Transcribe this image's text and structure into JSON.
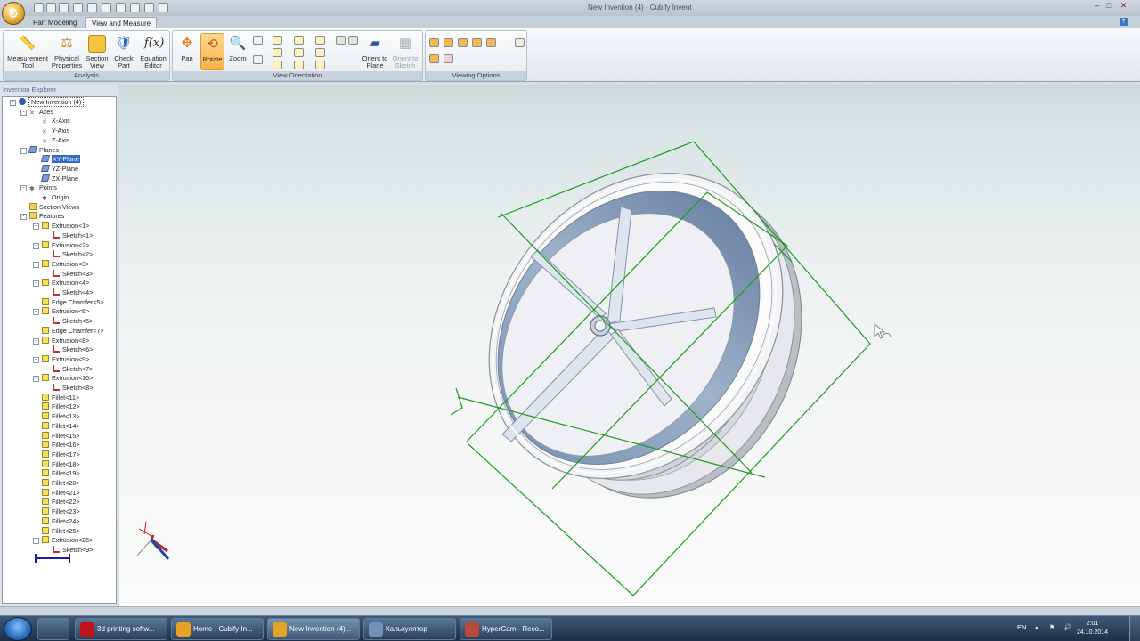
{
  "window": {
    "title": "New Invention (4) - Cubify Invent"
  },
  "tabs": [
    {
      "label": "Part Modeling"
    },
    {
      "label": "View and Measure"
    }
  ],
  "ribbon": {
    "analysis": {
      "label": "Analysis",
      "buttons": [
        {
          "label": "Measurement Tool",
          "icon": "ruler-icon"
        },
        {
          "label": "Physical Properties",
          "icon": "scale-icon"
        },
        {
          "label": "Section View",
          "icon": "section-icon"
        },
        {
          "label": "Check Part",
          "icon": "shield-icon"
        },
        {
          "label": "Equation Editor",
          "icon": "function-icon",
          "glyph": "f(x)"
        }
      ]
    },
    "view_orientation": {
      "label": "View Orientation",
      "buttons": [
        {
          "label": "Pan",
          "icon": "pan-icon"
        },
        {
          "label": "Rotate",
          "icon": "rotate-icon",
          "active": true
        },
        {
          "label": "Zoom",
          "icon": "zoom-icon"
        },
        {
          "label": "Orient to Plane",
          "icon": "orient-plane-icon"
        },
        {
          "label": "Orient to Sketch",
          "icon": "orient-sketch-icon",
          "disabled": true
        }
      ]
    },
    "viewing_options": {
      "label": "Viewing Options"
    }
  },
  "explorer": {
    "title": "Invention Explorer",
    "tree": [
      {
        "label": "New Invention (4)",
        "type": "root",
        "level": 0,
        "exp": "-"
      },
      {
        "label": "Axes",
        "type": "axis",
        "level": 1,
        "exp": "-"
      },
      {
        "label": "X-Axis",
        "type": "axis",
        "level": 2
      },
      {
        "label": "Y-Axis",
        "type": "axis",
        "level": 2
      },
      {
        "label": "Z-Axis",
        "type": "axis",
        "level": 2
      },
      {
        "label": "Planes",
        "type": "plane",
        "level": 1,
        "exp": "-"
      },
      {
        "label": "XY-Plane",
        "type": "plane",
        "level": 2,
        "selected": true
      },
      {
        "label": "YZ-Plane",
        "type": "plane",
        "level": 2
      },
      {
        "label": "ZX-Plane",
        "type": "plane",
        "level": 2
      },
      {
        "label": "Points",
        "type": "pt",
        "level": 1,
        "exp": "-"
      },
      {
        "label": "Origin",
        "type": "pt",
        "level": 2
      },
      {
        "label": "Section Views",
        "type": "folder",
        "level": 1
      },
      {
        "label": "Features",
        "type": "folder",
        "level": 1,
        "exp": "-"
      },
      {
        "label": "Extrusion<1>",
        "type": "feat",
        "level": 2,
        "exp": "-"
      },
      {
        "label": "Sketch<1>",
        "type": "sketch",
        "level": 3
      },
      {
        "label": "Extrusion<2>",
        "type": "feat",
        "level": 2,
        "exp": "-"
      },
      {
        "label": "Sketch<2>",
        "type": "sketch",
        "level": 3
      },
      {
        "label": "Extrusion<3>",
        "type": "feat",
        "level": 2,
        "exp": "-"
      },
      {
        "label": "Sketch<3>",
        "type": "sketch",
        "level": 3
      },
      {
        "label": "Extrusion<4>",
        "type": "feat",
        "level": 2,
        "exp": "-"
      },
      {
        "label": "Sketch<4>",
        "type": "sketch",
        "level": 3
      },
      {
        "label": "Edge Chamfer<5>",
        "type": "feat",
        "level": 2
      },
      {
        "label": "Extrusion<6>",
        "type": "feat",
        "level": 2,
        "exp": "-"
      },
      {
        "label": "Sketch<5>",
        "type": "sketch",
        "level": 3
      },
      {
        "label": "Edge Chamfer<7>",
        "type": "feat",
        "level": 2
      },
      {
        "label": "Extrusion<8>",
        "type": "feat",
        "level": 2,
        "exp": "-"
      },
      {
        "label": "Sketch<6>",
        "type": "sketch",
        "level": 3
      },
      {
        "label": "Extrusion<9>",
        "type": "feat",
        "level": 2,
        "exp": "-"
      },
      {
        "label": "Sketch<7>",
        "type": "sketch",
        "level": 3
      },
      {
        "label": "Extrusion<10>",
        "type": "feat",
        "level": 2,
        "exp": "-"
      },
      {
        "label": "Sketch<8>",
        "type": "sketch",
        "level": 3
      },
      {
        "label": "Fillet<11>",
        "type": "feat",
        "level": 2
      },
      {
        "label": "Fillet<12>",
        "type": "feat",
        "level": 2
      },
      {
        "label": "Fillet<13>",
        "type": "feat",
        "level": 2
      },
      {
        "label": "Fillet<14>",
        "type": "feat",
        "level": 2
      },
      {
        "label": "Fillet<15>",
        "type": "feat",
        "level": 2
      },
      {
        "label": "Fillet<16>",
        "type": "feat",
        "level": 2
      },
      {
        "label": "Fillet<17>",
        "type": "feat",
        "level": 2
      },
      {
        "label": "Fillet<18>",
        "type": "feat",
        "level": 2
      },
      {
        "label": "Fillet<19>",
        "type": "feat",
        "level": 2
      },
      {
        "label": "Fillet<20>",
        "type": "feat",
        "level": 2
      },
      {
        "label": "Fillet<21>",
        "type": "feat",
        "level": 2
      },
      {
        "label": "Fillet<22>",
        "type": "feat",
        "level": 2
      },
      {
        "label": "Fillet<23>",
        "type": "feat",
        "level": 2
      },
      {
        "label": "Fillet<24>",
        "type": "feat",
        "level": 2
      },
      {
        "label": "Fillet<25>",
        "type": "feat",
        "level": 2
      },
      {
        "label": "Extrusion<26>",
        "type": "feat",
        "level": 2,
        "exp": "-"
      },
      {
        "label": "Sketch<9>",
        "type": "sketch",
        "level": 3
      }
    ]
  },
  "taskbar": {
    "tasks": [
      {
        "label": "3d printing softw...",
        "icon": "opera-icon",
        "color": "#c0141c"
      },
      {
        "label": "Home - Cubify In...",
        "icon": "cubify-icon",
        "color": "#e5a226"
      },
      {
        "label": "New Invention (4)...",
        "icon": "cubify-icon",
        "color": "#e5a226",
        "active": true
      },
      {
        "label": "Калькулятор",
        "icon": "calculator-icon",
        "color": "#6f8fb5"
      },
      {
        "label": "HyperCam - Reco...",
        "icon": "hypercam-icon",
        "color": "#b84a3a"
      }
    ],
    "language": "EN",
    "time": "2:01",
    "date": "24.10.2014"
  }
}
